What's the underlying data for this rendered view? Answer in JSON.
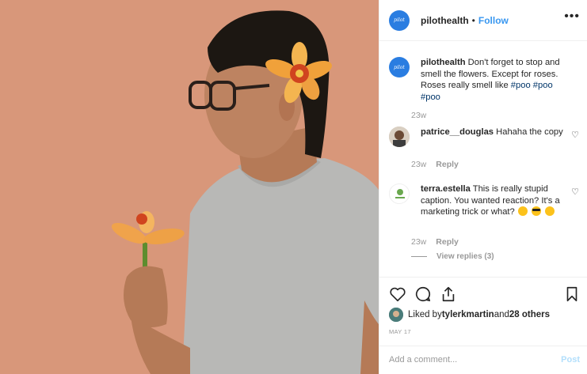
{
  "post": {
    "username": "pilothealth",
    "avatar_text": "pilot",
    "dot": "•",
    "follow_label": "Follow",
    "more_label": "•••"
  },
  "caption": {
    "username": "pilothealth",
    "text_plain": " Don't forget to stop and smell the flowers. Except for roses. Roses really smell like ",
    "tag1": "#poo",
    "tag2": "#poo",
    "tag3": "#poo",
    "age": "23w"
  },
  "comments": [
    {
      "username": "patrice__douglas",
      "text": " Hahaha the copy",
      "age": "23w",
      "reply_label": "Reply"
    },
    {
      "username": "terra.estella",
      "text": " This is really stupid caption. You wanted reaction? It's a marketing trick or what?",
      "age": "23w",
      "reply_label": "Reply",
      "view_replies": "View replies (3)"
    }
  ],
  "likes": {
    "prefix": "Liked by ",
    "user": "tylerkmartin",
    "middle": " and ",
    "others": "28 others"
  },
  "date": "MAY 17",
  "comment_box": {
    "placeholder": "Add a comment...",
    "post_label": "Post"
  },
  "colors": {
    "accent": "#3897f0",
    "photo_bg": "#d8977a",
    "avatar_bg": "#2a7de1"
  },
  "icons": [
    "heart-icon",
    "comment-icon",
    "share-icon",
    "bookmark-icon",
    "more-icon",
    "small-heart-icon"
  ]
}
